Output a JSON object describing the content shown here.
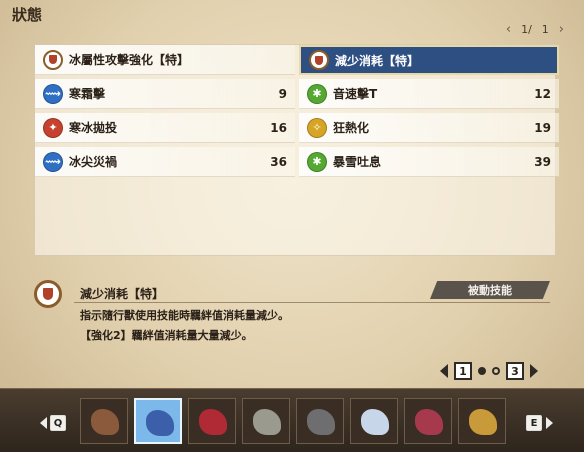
{
  "header": {
    "title": "狀態"
  },
  "pager": {
    "current": "1/",
    "total": "1"
  },
  "skills": {
    "left": [
      {
        "name": "冰屬性攻擊強化【特】",
        "level": "",
        "icon": "shield-icon",
        "color": "shield"
      },
      {
        "name": "寒霜擊",
        "level": "9",
        "icon": "runner-icon",
        "color": "blue"
      },
      {
        "name": "寒冰拋投",
        "level": "16",
        "icon": "throw-icon",
        "color": "red"
      },
      {
        "name": "冰尖災禍",
        "level": "36",
        "icon": "runner-icon",
        "color": "blue"
      }
    ],
    "right": [
      {
        "name": "減少消耗【特】",
        "level": "",
        "icon": "shield-icon",
        "color": "shield"
      },
      {
        "name": "音速擊T",
        "level": "12",
        "icon": "splash-icon",
        "color": "green"
      },
      {
        "name": "狂熱化",
        "level": "19",
        "icon": "flex-icon",
        "color": "yellow"
      },
      {
        "name": "暴雪吐息",
        "level": "39",
        "icon": "splash-icon",
        "color": "green"
      }
    ]
  },
  "detail": {
    "title": "減少消耗【特】",
    "tag": "被動技能",
    "line1": "指示隨行獸使用技能時羈絆值消耗量減少。",
    "line2": "【強化2】羈絆值消耗量大量減少。"
  },
  "page_indicator": {
    "first": "1",
    "last": "3"
  },
  "keys": {
    "prev": "Q",
    "next": "E"
  },
  "monsters": [
    {
      "icon": "knight-monster-icon",
      "color": "#8b5a3c"
    },
    {
      "icon": "ice-wyvern-monster-icon",
      "color": "#3b5fa8"
    },
    {
      "icon": "red-beast-monster-icon",
      "color": "#b02a36"
    },
    {
      "icon": "horn-beast-monster-icon",
      "color": "#9a9a8e"
    },
    {
      "icon": "grey-wyvern-monster-icon",
      "color": "#6e6e70"
    },
    {
      "icon": "frost-tiger-monster-icon",
      "color": "#c7d6e8"
    },
    {
      "icon": "crimson-serpent-monster-icon",
      "color": "#a63a4c"
    },
    {
      "icon": "golden-rider-monster-icon",
      "color": "#c89a3a"
    }
  ],
  "colors": {
    "selected_skill": "#2d4f82",
    "bottom_bar": "#3a2e24",
    "selected_monster": "#7db8ea"
  }
}
